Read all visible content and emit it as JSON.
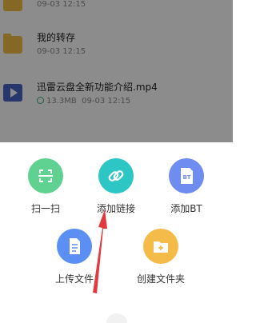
{
  "files": [
    {
      "name": "",
      "meta": "09-03 12:15",
      "type": "folder"
    },
    {
      "name": "我的转存",
      "meta": "09-03 12:15",
      "type": "folder"
    },
    {
      "name": "迅雷云盘全新功能介绍.mp4",
      "size": "13.3MB",
      "meta": "09-03 12:15",
      "type": "video"
    }
  ],
  "actions": {
    "scan": {
      "label": "扫一扫",
      "color": "#5fd191"
    },
    "add_link": {
      "label": "添加链接",
      "color": "#2cc7c5"
    },
    "add_bt": {
      "label": "添加BT",
      "color": "#6f8cf0",
      "icon_text": "BT"
    },
    "upload": {
      "label": "上传文件",
      "color": "#5c8ff3"
    },
    "new_folder": {
      "label": "创建文件夹",
      "color": "#f5bb48"
    }
  }
}
